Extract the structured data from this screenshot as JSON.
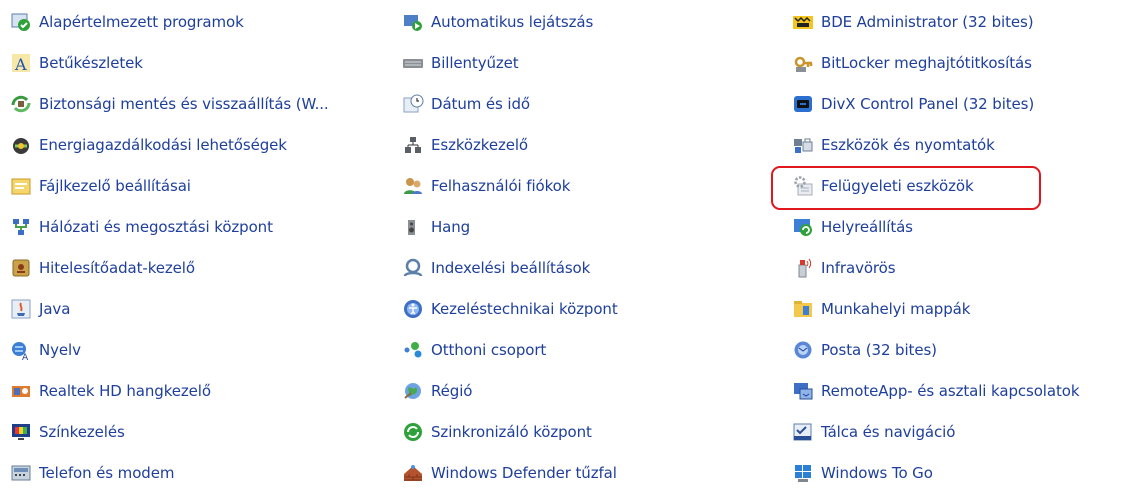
{
  "columns": [
    [
      {
        "label": "Alapértelmezett programok",
        "icon": "default-programs-icon"
      },
      {
        "label": "Betűkészletek",
        "icon": "fonts-icon"
      },
      {
        "label": "Biztonsági mentés és visszaállítás (W...",
        "icon": "backup-restore-icon"
      },
      {
        "label": "Energiagazdálkodási lehetőségek",
        "icon": "power-options-icon"
      },
      {
        "label": "Fájlkezelő beállításai",
        "icon": "file-explorer-options-icon"
      },
      {
        "label": "Hálózati és megosztási központ",
        "icon": "network-sharing-icon"
      },
      {
        "label": "Hitelesítőadat-kezelő",
        "icon": "credential-manager-icon"
      },
      {
        "label": "Java",
        "icon": "java-icon"
      },
      {
        "label": "Nyelv",
        "icon": "language-icon"
      },
      {
        "label": "Realtek HD hangkezelő",
        "icon": "realtek-audio-icon"
      },
      {
        "label": "Színkezelés",
        "icon": "color-management-icon"
      },
      {
        "label": "Telefon és modem",
        "icon": "phone-modem-icon"
      }
    ],
    [
      {
        "label": "Automatikus lejátszás",
        "icon": "autoplay-icon"
      },
      {
        "label": "Billentyűzet",
        "icon": "keyboard-icon"
      },
      {
        "label": "Dátum és idő",
        "icon": "date-time-icon"
      },
      {
        "label": "Eszközkezelő",
        "icon": "device-manager-icon"
      },
      {
        "label": "Felhasználói fiókok",
        "icon": "user-accounts-icon"
      },
      {
        "label": "Hang",
        "icon": "sound-icon"
      },
      {
        "label": "Indexelési beállítások",
        "icon": "indexing-options-icon"
      },
      {
        "label": "Kezeléstechnikai központ",
        "icon": "ease-of-access-icon"
      },
      {
        "label": "Otthoni csoport",
        "icon": "homegroup-icon"
      },
      {
        "label": "Régió",
        "icon": "region-icon"
      },
      {
        "label": "Szinkronizáló központ",
        "icon": "sync-center-icon"
      },
      {
        "label": "Windows Defender tűzfal",
        "icon": "firewall-icon"
      }
    ],
    [
      {
        "label": "BDE Administrator (32 bites)",
        "icon": "bde-administrator-icon"
      },
      {
        "label": "BitLocker meghajtótitkosítás",
        "icon": "bitlocker-icon"
      },
      {
        "label": "DivX Control Panel (32 bites)",
        "icon": "divx-icon"
      },
      {
        "label": "Eszközök és nyomtatók",
        "icon": "devices-printers-icon"
      },
      {
        "label": "Felügyeleti eszközök",
        "icon": "administrative-tools-icon"
      },
      {
        "label": "Helyreállítás",
        "icon": "recovery-icon"
      },
      {
        "label": "Infravörös",
        "icon": "infrared-icon"
      },
      {
        "label": "Munkahelyi mappák",
        "icon": "work-folders-icon"
      },
      {
        "label": "Posta (32 bites)",
        "icon": "mail-icon"
      },
      {
        "label": "RemoteApp- és asztali kapcsolatok",
        "icon": "remoteapp-icon"
      },
      {
        "label": "Tálca és navigáció",
        "icon": "taskbar-navigation-icon"
      },
      {
        "label": "Windows To Go",
        "icon": "windows-to-go-icon"
      }
    ]
  ],
  "highlighted_item": "Felügyeleti eszközök",
  "colors": {
    "link": "#1e3f9c",
    "highlight": "#e0181e",
    "background": "#ffffff"
  }
}
